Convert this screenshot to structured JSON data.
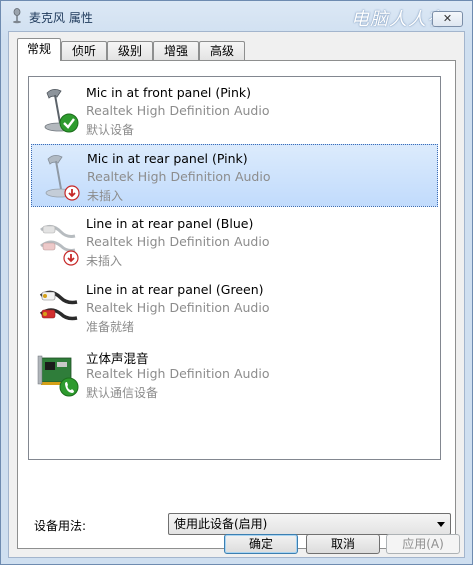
{
  "window": {
    "title": "麦克风 属性",
    "close_glyph": "✕",
    "watermark": "电脑人人有"
  },
  "tabs": [
    {
      "label": "常规",
      "active": true
    },
    {
      "label": "侦听",
      "active": false
    },
    {
      "label": "级别",
      "active": false
    },
    {
      "label": "增强",
      "active": false
    },
    {
      "label": "高级",
      "active": false
    }
  ],
  "devices": [
    {
      "name": "Mic in at front panel (Pink)",
      "driver": "Realtek High Definition Audio",
      "status": "默认设备",
      "icon": "microphone-icon",
      "badge": "default-check-badge",
      "selected": false
    },
    {
      "name": "Mic in at rear panel (Pink)",
      "driver": "Realtek High Definition Audio",
      "status": "未插入",
      "icon": "microphone-icon",
      "badge": "unplugged-badge",
      "selected": true
    },
    {
      "name": "Line in at rear panel (Blue)",
      "driver": "Realtek High Definition Audio",
      "status": "未插入",
      "icon": "rca-cable-icon",
      "badge": "unplugged-badge",
      "selected": false
    },
    {
      "name": "Line in at rear panel (Green)",
      "driver": "Realtek High Definition Audio",
      "status": "准备就绪",
      "icon": "rca-cable-icon",
      "badge": "",
      "selected": false
    },
    {
      "name": "立体声混音",
      "driver": "Realtek High Definition Audio",
      "status": "默认通信设备",
      "icon": "sound-card-icon",
      "badge": "communication-phone-badge",
      "selected": false
    }
  ],
  "device_usage": {
    "label": "设备用法:",
    "value": "使用此设备(启用)"
  },
  "buttons": {
    "ok": "确定",
    "cancel": "取消",
    "apply": "应用(A)"
  },
  "colors": {
    "selection": "#c1dbfc",
    "accent_green": "#2e9b2e",
    "unplugged_red": "#c62828"
  }
}
